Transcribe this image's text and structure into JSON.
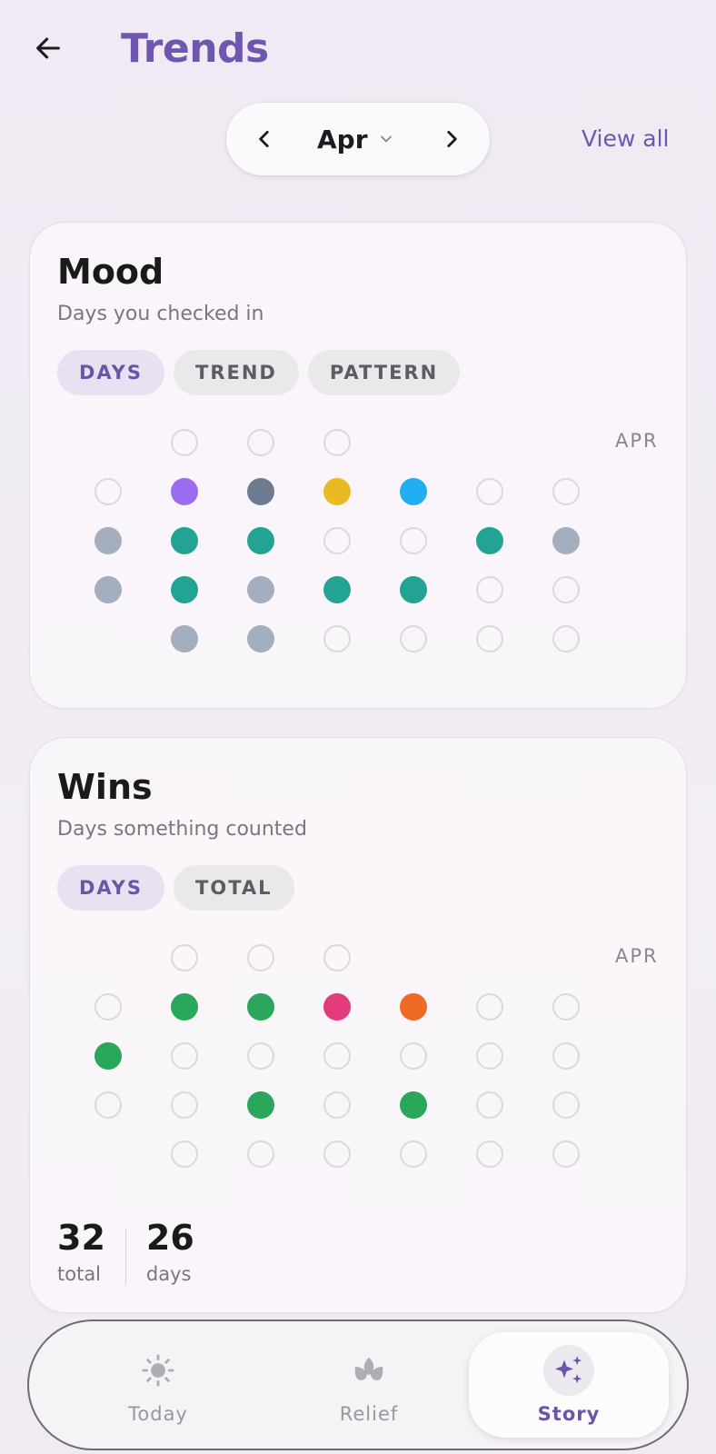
{
  "header": {
    "title": "Trends"
  },
  "month_selector": {
    "month": "Apr",
    "view_all": "View all"
  },
  "mood": {
    "title": "Mood",
    "subtitle": "Days you checked in",
    "chips": [
      {
        "label": "DAYS",
        "active": true
      },
      {
        "label": "TREND",
        "active": false
      },
      {
        "label": "PATTERN",
        "active": false
      }
    ],
    "month_label": "APR",
    "rows": [
      [
        null,
        "empty",
        "empty",
        "empty"
      ],
      [
        "empty",
        "#9b6cf0",
        "#6e7c92",
        "#e9bb22",
        "#22aef0",
        "empty",
        "empty"
      ],
      [
        "#a3aebe",
        "#23a394",
        "#23a394",
        "empty",
        "empty",
        "#23a394",
        "#a3aebe"
      ],
      [
        "#a3aebe",
        "#23a394",
        "#a3aebe",
        "#23a394",
        "#23a394",
        "empty",
        "empty"
      ],
      [
        null,
        "#a3aebe",
        "#a3aebe",
        "empty",
        "empty",
        "empty",
        "empty"
      ]
    ]
  },
  "wins": {
    "title": "Wins",
    "subtitle": "Days something counted",
    "chips": [
      {
        "label": "DAYS",
        "active": true
      },
      {
        "label": "TOTAL",
        "active": false
      }
    ],
    "month_label": "APR",
    "rows": [
      [
        null,
        "empty",
        "empty",
        "empty"
      ],
      [
        "empty",
        "#2aa75a",
        "#2aa75a",
        "#e33b7c",
        "#ee6a25",
        "empty",
        "empty"
      ],
      [
        "#2aa75a",
        "empty",
        "empty",
        "empty",
        "empty",
        "empty",
        "empty"
      ],
      [
        "empty",
        "empty",
        "#2aa75a",
        "empty",
        "#2aa75a",
        "empty",
        "empty"
      ],
      [
        null,
        "empty",
        "empty",
        "empty",
        "empty",
        "empty",
        "empty"
      ]
    ],
    "stats": {
      "total_value": "32",
      "total_label": "total",
      "days_value": "26",
      "days_label": "days"
    }
  },
  "nav": {
    "today": "Today",
    "relief": "Relief",
    "story": "Story",
    "active": "story"
  },
  "colors": {
    "accent": "#6f57b0",
    "empty_ring": "#dcd8dd"
  }
}
